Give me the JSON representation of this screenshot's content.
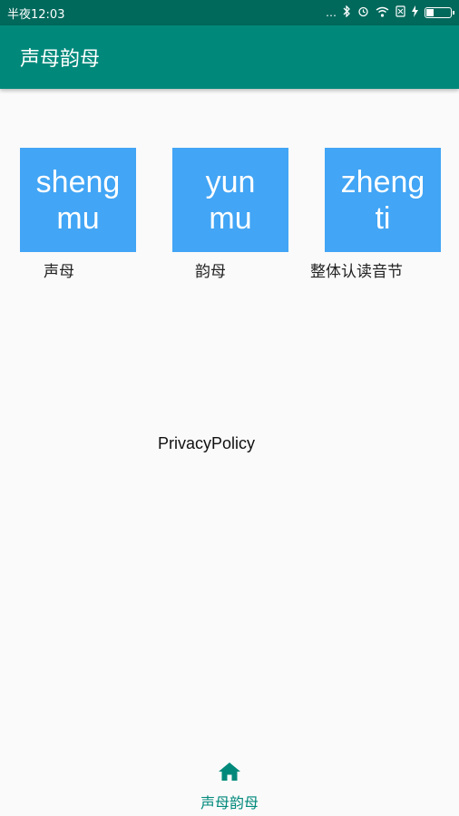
{
  "status_bar": {
    "time": "半夜12:03",
    "icons": [
      "signal-dots-icon",
      "bluetooth-icon",
      "alarm-icon",
      "wifi-icon",
      "sim-icon",
      "charging-icon",
      "battery-icon"
    ]
  },
  "app_bar": {
    "title": "声母韵母"
  },
  "cards": [
    {
      "line1": "sheng",
      "line2": "mu",
      "label": "声母"
    },
    {
      "line1": "yun",
      "line2": "mu",
      "label": "韵母"
    },
    {
      "line1": "zheng",
      "line2": "ti",
      "label": "整体认读音节"
    }
  ],
  "privacy_link": "PrivacyPolicy",
  "bottom_nav": {
    "home_label": "声母韵母"
  },
  "colors": {
    "status_bar": "#00695c",
    "app_bar": "#00897b",
    "card": "#42a5f5",
    "nav_active": "#00897b"
  }
}
